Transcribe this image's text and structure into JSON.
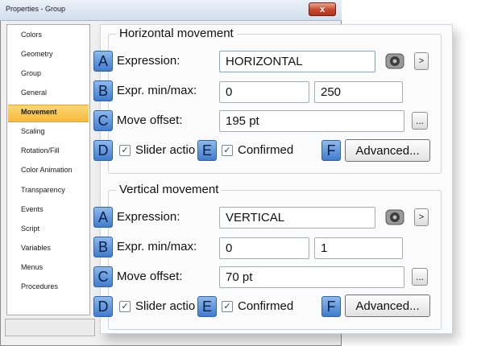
{
  "window": {
    "title": "Properties - Group",
    "close_label": "x"
  },
  "sidebar": {
    "selected": "Movement",
    "items": [
      "Colors",
      "Geometry",
      "Group",
      "General",
      "Movement",
      "Scaling",
      "Rotation/Fill",
      "Color Animation",
      "Transparency",
      "Events",
      "Script",
      "Variables",
      "Menus",
      "Procedures"
    ]
  },
  "horizontal": {
    "title": "Horizontal movement",
    "expression_label": "Expression:",
    "expression_value": "HORIZONTAL",
    "minmax_label": "Expr. min/max:",
    "min_value": "0",
    "max_value": "250",
    "offset_label": "Move offset:",
    "offset_value": "195 pt",
    "slider_label": "Slider actio",
    "confirmed_label": "Confirmed",
    "advanced_label": "Advanced...",
    "next_label": ">",
    "dots_label": "..."
  },
  "vertical": {
    "title": "Vertical movement",
    "expression_label": "Expression:",
    "expression_value": "VERTICAL",
    "minmax_label": "Expr. min/max:",
    "min_value": "0",
    "max_value": "1",
    "offset_label": "Move offset:",
    "offset_value": "70 pt",
    "slider_label": "Slider actio",
    "confirmed_label": "Confirmed",
    "advanced_label": "Advanced...",
    "next_label": ">",
    "dots_label": "..."
  },
  "badges": {
    "a": "A",
    "b": "B",
    "c": "C",
    "d": "D",
    "e": "E",
    "f": "F"
  },
  "checkmark": "✓",
  "colors": {
    "badge": "#4f87d6",
    "selected_item": "#f6b93c",
    "close_button": "#c8452a"
  },
  "icons": [
    "gear-icon",
    "close-icon",
    "chevron-right-icon",
    "ellipsis-icon"
  ]
}
